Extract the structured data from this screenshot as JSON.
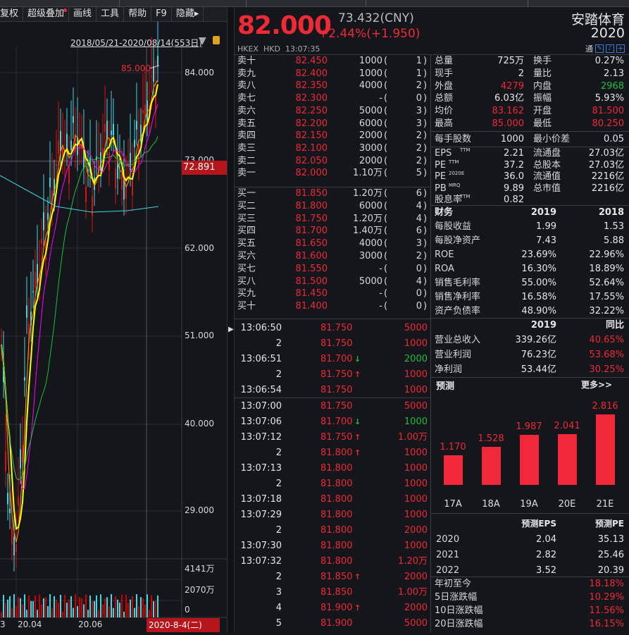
{
  "toolbar": {
    "items": [
      "复权",
      "超级叠加",
      "画线",
      "工具",
      "帮助",
      "F9",
      "隐藏"
    ]
  },
  "chart": {
    "range_label": "2018/05/21-2020/08/14(553日)",
    "high_marker": "85.000",
    "price_axis": [
      "84.000",
      "73.000",
      "62.000",
      "51.000",
      "40.000",
      "29.000"
    ],
    "crosshair_price": "72.891",
    "volume_axis": [
      "4141万",
      "2070万",
      "0"
    ],
    "x_labels": [
      "3",
      "20.04",
      "20.06"
    ],
    "crosshair_date": "2020-8-4(二)",
    "colors": {
      "ma5": "#ffff00",
      "ma10": "#ff9900",
      "ma20": "#ff00ff",
      "ma60": "#1fbf3a",
      "ma120": "#3fd7e0",
      "up": "#dd1111",
      "down": "#3fd7e0"
    }
  },
  "header": {
    "price": "82.000",
    "cny": "73.432(CNY)",
    "change": "+2.44%(+1.950)",
    "exchange": "HKEX",
    "currency": "HKD",
    "time": "13:07:35",
    "name": "安踏体育",
    "code": "2020",
    "icons": [
      "通",
      "edit-icon",
      "bell-icon",
      "plus-icon"
    ]
  },
  "asks": [
    {
      "label": "卖十",
      "price": "82.450",
      "vol": "1000",
      "n": "1"
    },
    {
      "label": "卖九",
      "price": "82.400",
      "vol": "1000",
      "n": "1"
    },
    {
      "label": "卖八",
      "price": "82.350",
      "vol": "4000",
      "n": "2"
    },
    {
      "label": "卖七",
      "price": "82.300",
      "vol": "-",
      "n": "0"
    },
    {
      "label": "卖六",
      "price": "82.250",
      "vol": "5000",
      "n": "3"
    },
    {
      "label": "卖五",
      "price": "82.200",
      "vol": "6000",
      "n": "3"
    },
    {
      "label": "卖四",
      "price": "82.150",
      "vol": "2000",
      "n": "2"
    },
    {
      "label": "卖三",
      "price": "82.100",
      "vol": "3000",
      "n": "2"
    },
    {
      "label": "卖二",
      "price": "82.050",
      "vol": "2000",
      "n": "2"
    },
    {
      "label": "卖一",
      "price": "82.000",
      "vol": "1.10万",
      "n": "5"
    }
  ],
  "bids": [
    {
      "label": "买一",
      "price": "81.850",
      "vol": "1.20万",
      "n": "6"
    },
    {
      "label": "买二",
      "price": "81.800",
      "vol": "6000",
      "n": "4"
    },
    {
      "label": "买三",
      "price": "81.750",
      "vol": "1.20万",
      "n": "4"
    },
    {
      "label": "买四",
      "price": "81.700",
      "vol": "1.40万",
      "n": "6"
    },
    {
      "label": "买五",
      "price": "81.650",
      "vol": "4000",
      "n": "3"
    },
    {
      "label": "买六",
      "price": "81.600",
      "vol": "3000",
      "n": "2"
    },
    {
      "label": "买七",
      "price": "81.550",
      "vol": "-",
      "n": "0"
    },
    {
      "label": "买八",
      "price": "81.500",
      "vol": "5000",
      "n": "4"
    },
    {
      "label": "买九",
      "price": "81.450",
      "vol": "-",
      "n": "0"
    },
    {
      "label": "买十",
      "price": "81.400",
      "vol": "-",
      "n": "0"
    }
  ],
  "trades": [
    {
      "t": "13:06:50",
      "p": "81.750",
      "d": "",
      "v": "5000",
      "c": "red"
    },
    {
      "t": "2",
      "p": "81.750",
      "d": "",
      "v": "1000",
      "c": "red"
    },
    {
      "t": "13:06:51",
      "p": "81.700",
      "d": "down",
      "v": "2000",
      "c": "green"
    },
    {
      "t": "2",
      "p": "81.750",
      "d": "up",
      "v": "1000",
      "c": "red"
    },
    {
      "t": "13:06:54",
      "p": "81.750",
      "d": "",
      "v": "1000",
      "c": "red"
    },
    {
      "t": "13:07:00",
      "p": "81.750",
      "d": "",
      "v": "5000",
      "c": "red"
    },
    {
      "t": "13:07:06",
      "p": "81.700",
      "d": "down",
      "v": "1000",
      "c": "green"
    },
    {
      "t": "13:07:12",
      "p": "81.750",
      "d": "up",
      "v": "1.00万",
      "c": "red"
    },
    {
      "t": "2",
      "p": "81.800",
      "d": "up",
      "v": "1000",
      "c": "red"
    },
    {
      "t": "13:07:13",
      "p": "81.800",
      "d": "",
      "v": "1000",
      "c": "red"
    },
    {
      "t": "2",
      "p": "81.800",
      "d": "",
      "v": "1000",
      "c": "red"
    },
    {
      "t": "13:07:18",
      "p": "81.800",
      "d": "",
      "v": "1000",
      "c": "red"
    },
    {
      "t": "13:07:29",
      "p": "81.800",
      "d": "",
      "v": "1000",
      "c": "red"
    },
    {
      "t": "2",
      "p": "81.800",
      "d": "",
      "v": "2000",
      "c": "red"
    },
    {
      "t": "13:07:30",
      "p": "81.800",
      "d": "",
      "v": "1000",
      "c": "red"
    },
    {
      "t": "13:07:32",
      "p": "81.800",
      "d": "",
      "v": "1.20万",
      "c": "red"
    },
    {
      "t": "2",
      "p": "81.850",
      "d": "up",
      "v": "2000",
      "c": "red"
    },
    {
      "t": "3",
      "p": "81.850",
      "d": "",
      "v": "1.00万",
      "c": "red"
    },
    {
      "t": "4",
      "p": "81.900",
      "d": "up",
      "v": "2000",
      "c": "red"
    },
    {
      "t": "5",
      "p": "81.900",
      "d": "",
      "v": "5000",
      "c": "red"
    }
  ],
  "stats": [
    {
      "l1": "总量",
      "v1": "725万",
      "c1": "white",
      "l2": "换手",
      "v2": "0.27%",
      "c2": "white"
    },
    {
      "l1": "现手",
      "v1": "2",
      "c1": "white",
      "l2": "量比",
      "v2": "2.13",
      "c2": "white"
    },
    {
      "l1": "外盘",
      "v1": "4279",
      "c1": "red",
      "l2": "内盘",
      "v2": "2968",
      "c2": "green"
    },
    {
      "l1": "总额",
      "v1": "6.03亿",
      "c1": "white",
      "l2": "振幅",
      "v2": "5.93%",
      "c2": "white"
    },
    {
      "l1": "均价",
      "v1": "83.162",
      "c1": "red",
      "l2": "开盘",
      "v2": "81.500",
      "c2": "red"
    },
    {
      "l1": "最高",
      "v1": "85.000",
      "c1": "red",
      "l2": "最低",
      "v2": "80.250",
      "c2": "red"
    }
  ],
  "lot": {
    "l1": "每手股数",
    "v1": "1000",
    "l2": "最小价差",
    "v2": "0.05"
  },
  "valuation": [
    {
      "l1": "EPS",
      "s1": "TTM",
      "v1": "2.21",
      "l2": "流通盘",
      "v2": "27.03亿"
    },
    {
      "l1": "PE",
      "s1": "TTM",
      "v1": "37.2",
      "l2": "总股本",
      "v2": "27.03亿"
    },
    {
      "l1": "PE",
      "s1": "2020E",
      "v1": "36.0",
      "l2": "流通值",
      "v2": "2216亿"
    },
    {
      "l1": "PB",
      "s1": "MRQ",
      "v1": "9.89",
      "l2": "总市值",
      "v2": "2216亿"
    },
    {
      "l1": "股息率",
      "s1": "TTM",
      "v1": "0.82",
      "l2": "",
      "v2": ""
    }
  ],
  "finance": {
    "title": "财务",
    "col1": "2019",
    "col2": "2018",
    "rows": [
      {
        "l": "每股收益",
        "a": "1.99",
        "b": "1.53"
      },
      {
        "l": "每股净资产",
        "a": "7.43",
        "b": "5.88"
      },
      {
        "l": "ROE",
        "a": "23.69%",
        "b": "22.96%"
      },
      {
        "l": "ROA",
        "a": "16.30%",
        "b": "18.89%"
      },
      {
        "l": "销售毛利率",
        "a": "55.00%",
        "b": "52.64%"
      },
      {
        "l": "销售净利率",
        "a": "16.58%",
        "b": "17.55%"
      },
      {
        "l": "资产负债率",
        "a": "48.90%",
        "b": "32.22%"
      }
    ]
  },
  "income": {
    "col1": "2019",
    "col2": "同比",
    "rows": [
      {
        "l": "营业总收入",
        "a": "339.26亿",
        "b": "40.65%"
      },
      {
        "l": "营业利润",
        "a": "76.23亿",
        "b": "53.68%"
      },
      {
        "l": "净利润",
        "a": "53.44亿",
        "b": "30.25%"
      }
    ]
  },
  "forecast": {
    "title": "预测",
    "more": "更多>>",
    "chart_data": {
      "type": "bar",
      "categories": [
        "17A",
        "18A",
        "19A",
        "20E",
        "21E"
      ],
      "values": [
        1.17,
        1.528,
        1.987,
        2.041,
        2.816
      ],
      "labels": [
        "1.170",
        "1.528",
        "1.987",
        "2.041",
        "2.816"
      ]
    },
    "table": {
      "col1": "预测EPS",
      "col2": "预测PE",
      "rows": [
        {
          "y": "2020",
          "eps": "2.04",
          "pe": "35.13"
        },
        {
          "y": "2021",
          "eps": "2.82",
          "pe": "25.46"
        },
        {
          "y": "2022",
          "eps": "3.52",
          "pe": "20.39"
        }
      ]
    }
  },
  "performance": [
    {
      "l": "年初至今",
      "v": "18.18%"
    },
    {
      "l": "5日涨跌幅",
      "v": "10.29%"
    },
    {
      "l": "10日涨跌幅",
      "v": "11.56%"
    },
    {
      "l": "20日涨跌幅",
      "v": "16.15%"
    }
  ]
}
